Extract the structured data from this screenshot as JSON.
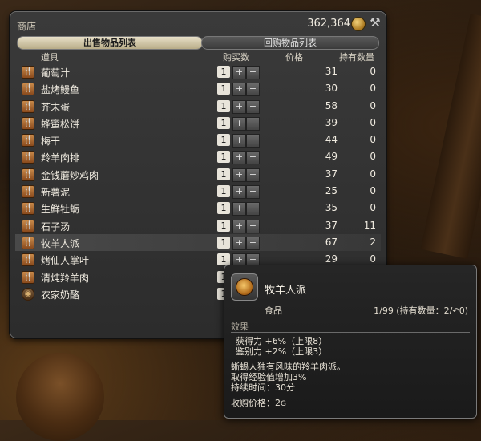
{
  "window": {
    "title": "商店",
    "gil": "362,364"
  },
  "tabs": {
    "sell": "出售物品列表",
    "buyback": "回购物品列表"
  },
  "columns": {
    "item": "道具",
    "qty": "购买数",
    "price": "价格",
    "owned": "持有数量"
  },
  "items": [
    {
      "name": "葡萄汁",
      "qty": "1",
      "price": "31",
      "owned": "0"
    },
    {
      "name": "盐烤鳗鱼",
      "qty": "1",
      "price": "30",
      "owned": "0"
    },
    {
      "name": "芥末蛋",
      "qty": "1",
      "price": "58",
      "owned": "0"
    },
    {
      "name": "蜂蜜松饼",
      "qty": "1",
      "price": "39",
      "owned": "0"
    },
    {
      "name": "梅干",
      "qty": "1",
      "price": "44",
      "owned": "0"
    },
    {
      "name": "羚羊肉排",
      "qty": "1",
      "price": "49",
      "owned": "0"
    },
    {
      "name": "金钱蘑炒鸡肉",
      "qty": "1",
      "price": "37",
      "owned": "0"
    },
    {
      "name": "新薯泥",
      "qty": "1",
      "price": "25",
      "owned": "0"
    },
    {
      "name": "生鲜牡蛎",
      "qty": "1",
      "price": "35",
      "owned": "0"
    },
    {
      "name": "石子汤",
      "qty": "1",
      "price": "37",
      "owned": "11"
    },
    {
      "name": "牧羊人派",
      "qty": "1",
      "price": "67",
      "owned": "2"
    },
    {
      "name": "烤仙人掌叶",
      "qty": "1",
      "price": "29",
      "owned": "0"
    },
    {
      "name": "清炖羚羊肉",
      "qty": "1",
      "price": "",
      "owned": ""
    },
    {
      "name": "农家奶酪",
      "qty": "1",
      "price": "",
      "owned": ""
    }
  ],
  "btn": {
    "plus": "+",
    "minus": "−"
  },
  "tooltip": {
    "name": "牧羊人派",
    "category": "食品",
    "stack": "1/99 (持有数量：2/",
    "stack_tail": "0)",
    "effect_title": "效果",
    "effects": [
      "获得力 +6%（上限8）",
      "鉴别力 +2%（上限3）"
    ],
    "desc": [
      "蜥蜴人独有风味的羚羊肉派。",
      "取得经验值增加3%",
      "持续时间：30分"
    ],
    "sell_price": "收购价格：2",
    "sell_price_unit": "G"
  }
}
